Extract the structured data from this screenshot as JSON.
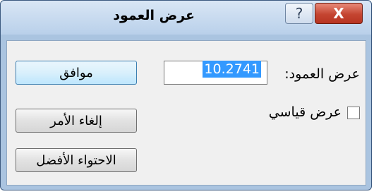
{
  "window": {
    "title": "عرض العمود",
    "close_glyph": "X",
    "help_glyph": "?"
  },
  "form": {
    "column_width_label": "عرض العمود:",
    "column_width_value": "10.2741",
    "standard_width_label": "عرض قياسي",
    "standard_width_checked": false
  },
  "buttons": {
    "ok": "موافق",
    "cancel": "إلغاء الأمر",
    "best_fit": "الاحتواء الأفضل"
  },
  "colors": {
    "close_button": "#c44531",
    "selection": "#3399ff"
  }
}
